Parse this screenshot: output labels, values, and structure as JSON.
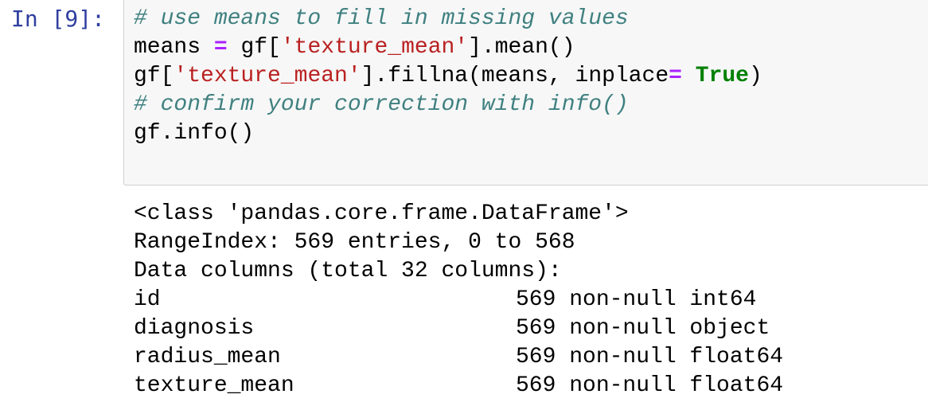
{
  "cell": {
    "prompt": "In [9]:",
    "code_lines": [
      [
        {
          "t": "# use means to fill in missing values",
          "c": "comment"
        }
      ],
      [
        {
          "t": "means ",
          "c": ""
        },
        {
          "t": "=",
          "c": "op"
        },
        {
          "t": " gf[",
          "c": ""
        },
        {
          "t": "'texture_mean'",
          "c": "string"
        },
        {
          "t": "].mean()",
          "c": ""
        }
      ],
      [
        {
          "t": "gf[",
          "c": ""
        },
        {
          "t": "'texture_mean'",
          "c": "string"
        },
        {
          "t": "].fillna(means, inplace",
          "c": ""
        },
        {
          "t": "=",
          "c": "op"
        },
        {
          "t": " ",
          "c": ""
        },
        {
          "t": "True",
          "c": "keyword"
        },
        {
          "t": ")",
          "c": ""
        }
      ],
      [
        {
          "t": "# confirm your correction with info()",
          "c": "comment"
        }
      ],
      [
        {
          "t": "gf.info()",
          "c": ""
        }
      ]
    ]
  },
  "output": {
    "header_lines": [
      "<class 'pandas.core.frame.DataFrame'>",
      "RangeIndex: 569 entries, 0 to 568",
      "Data columns (total 32 columns):"
    ],
    "columns": [
      {
        "name": "id",
        "info": "569 non-null int64"
      },
      {
        "name": "diagnosis",
        "info": "569 non-null object"
      },
      {
        "name": "radius_mean",
        "info": "569 non-null float64"
      },
      {
        "name": "texture_mean",
        "info": "569 non-null float64"
      }
    ]
  }
}
